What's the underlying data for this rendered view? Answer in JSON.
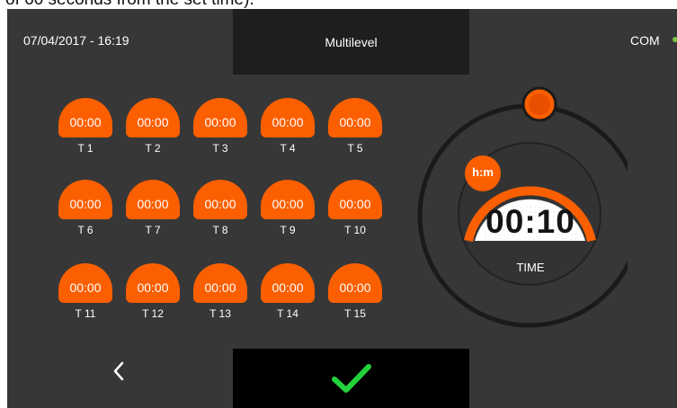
{
  "caption_fragment": "of 60 seconds from the set time).",
  "header": {
    "datetime": "07/04/2017 - 16:19",
    "title": "Multilevel",
    "com_label": "COM",
    "com_status_color": "#7ac142"
  },
  "timers": [
    {
      "value": "00:00",
      "label": "T 1"
    },
    {
      "value": "00:00",
      "label": "T 2"
    },
    {
      "value": "00:00",
      "label": "T 3"
    },
    {
      "value": "00:00",
      "label": "T 4"
    },
    {
      "value": "00:00",
      "label": "T 5"
    },
    {
      "value": "00:00",
      "label": "T 6"
    },
    {
      "value": "00:00",
      "label": "T 7"
    },
    {
      "value": "00:00",
      "label": "T 8"
    },
    {
      "value": "00:00",
      "label": "T 9"
    },
    {
      "value": "00:00",
      "label": "T 10"
    },
    {
      "value": "00:00",
      "label": "T 11"
    },
    {
      "value": "00:00",
      "label": "T 12"
    },
    {
      "value": "00:00",
      "label": "T 13"
    },
    {
      "value": "00:00",
      "label": "T 14"
    },
    {
      "value": "00:00",
      "label": "T 15"
    }
  ],
  "dial": {
    "unit_badge": "h:m",
    "value": "00:10",
    "label": "TIME"
  },
  "footer": {
    "back_icon": "chevron-left-icon",
    "confirm_icon": "check-icon",
    "confirm_color": "#22d23a"
  },
  "colors": {
    "accent": "#fb5f00",
    "background": "#373737",
    "panel": "#1e1e1e"
  }
}
